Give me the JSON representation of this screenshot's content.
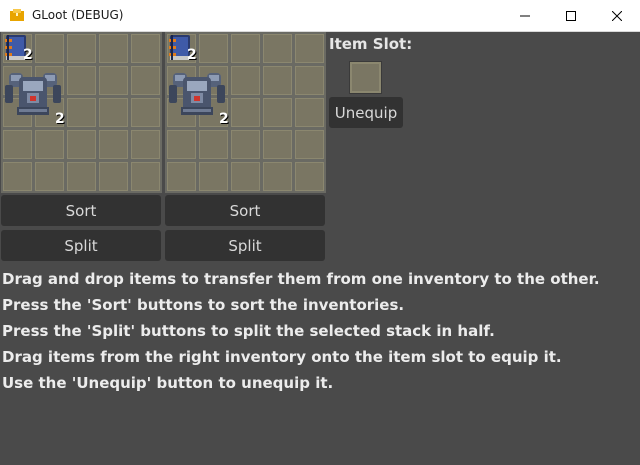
{
  "window": {
    "title": "GLoot (DEBUG)"
  },
  "inventories": [
    {
      "items": [
        {
          "type": "book",
          "count": "2"
        },
        {
          "type": "armor",
          "count": "2"
        }
      ],
      "sort_label": "Sort",
      "split_label": "Split"
    },
    {
      "items": [
        {
          "type": "book",
          "count": "2"
        },
        {
          "type": "armor",
          "count": "2"
        }
      ],
      "sort_label": "Sort",
      "split_label": "Split"
    }
  ],
  "item_slot": {
    "label": "Item Slot:",
    "unequip_label": "Unequip"
  },
  "instructions": [
    "Drag and drop items to transfer them from one inventory to the other.",
    "Press the 'Sort' buttons to sort the inventories.",
    "Press the 'Split' buttons to split the selected stack in half.",
    "Drag items from the right inventory onto the item slot to equip it.",
    "Use the 'Unequip' button to unequip it."
  ],
  "colors": {
    "background": "#4a4a4a",
    "cell": "#7a7663",
    "button": "#323232",
    "text": "#ececec"
  }
}
